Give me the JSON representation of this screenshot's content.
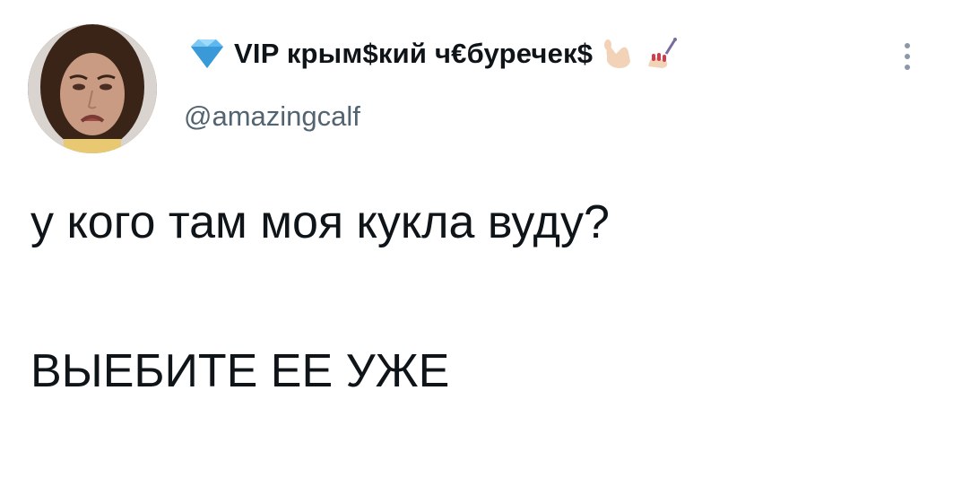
{
  "user": {
    "display_name": "VIP крым$кий ч€буречек$",
    "handle": "@amazingcalf",
    "avatar_alt": "",
    "verified_icon": "diamond-icon",
    "trailing_emojis": [
      "call-me-hand-icon",
      "nail-polish-icon"
    ]
  },
  "tweet": {
    "line1": "у кого там моя кукла вуду?",
    "line2": "ВЫЕБИТЕ ЕЕ УЖЕ"
  },
  "colors": {
    "text": "#0f1419",
    "secondary": "#536471",
    "diamond": "#5bb8f0"
  }
}
